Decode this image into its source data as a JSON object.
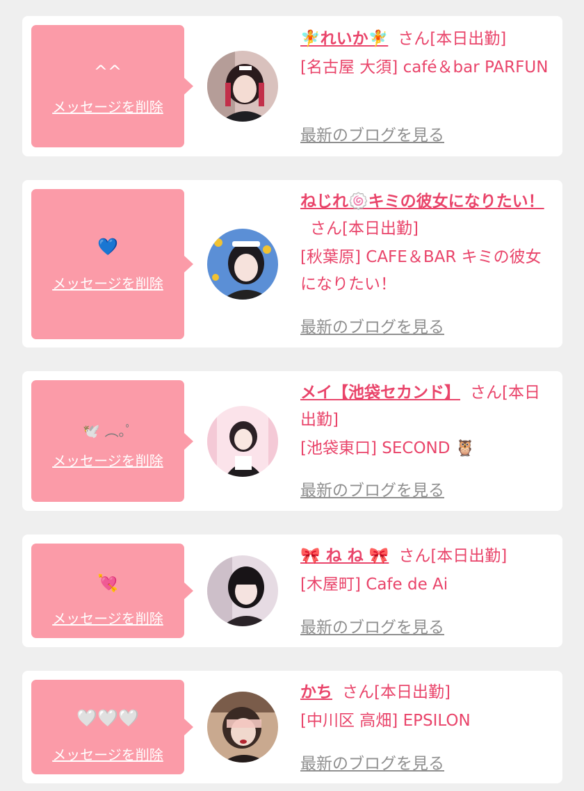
{
  "common": {
    "delete_label": "メッセージを削除",
    "blog_label": "最新のブログを見る"
  },
  "cards": [
    {
      "message": "^^",
      "name": "🧚れいか🧚",
      "suffix": "さん[本日出勤]",
      "shop": "[名古屋 大須] café＆bar PARFUN"
    },
    {
      "message": "💙",
      "name": "ねじれ🍥キミの彼女になりたい！",
      "suffix": "さん[本日出勤]",
      "shop": "[秋葉原] CAFE＆BAR キミの彼女になりたい！"
    },
    {
      "message": "🕊️ ︵｡ﾟ",
      "name": "メイ【池袋セカンド】",
      "suffix": "さん[本日出勤]",
      "shop": "[池袋東口] SECOND 🦉"
    },
    {
      "message": "💘",
      "name": "🎀 ね ね 🎀",
      "suffix": "さん[本日出勤]",
      "shop": "[木屋町] Cafe de Ai"
    },
    {
      "message": "🤍🤍🤍",
      "name": "かち",
      "suffix": "さん[本日出勤]",
      "shop": "[中川区 高畑] EPSILON"
    }
  ],
  "colors": {
    "accent": "#e9446a",
    "bubble": "#fb9ba8",
    "muted": "#8f8f8f",
    "background": "#efefef"
  }
}
